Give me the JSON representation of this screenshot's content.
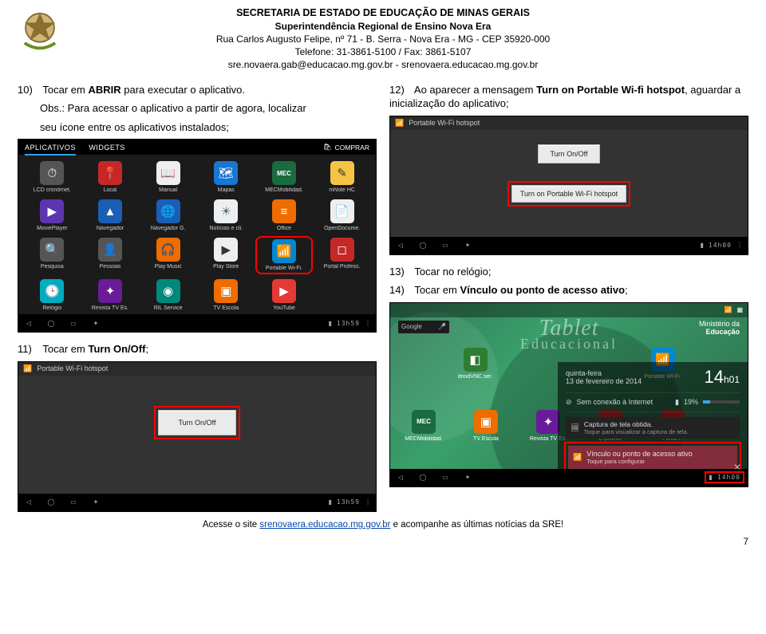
{
  "header": {
    "line1": "SECRETARIA DE ESTADO DE EDUCAÇÃO DE MINAS GERAIS",
    "line2": "Superintendência Regional de Ensino Nova Era",
    "line3": "Rua Carlos Augusto Felipe, nº 71 - B. Serra - Nova Era - MG - CEP 35920-000",
    "line4": "Telefone: 31-3861-5100 / Fax: 3861-5107",
    "line5": "sre.novaera.gab@educacao.mg.gov.br - srenovaera.educacao.mg.gov.br"
  },
  "left": {
    "step10_num": "10)",
    "step10_a": "Tocar em ",
    "step10_b": "ABRIR",
    "step10_c": " para executar o aplicativo.",
    "obs_a": "Obs.: Para acessar o aplicativo a partir de agora, localizar",
    "obs_b": "seu ícone entre os aplicativos instalados;",
    "drawer": {
      "tab1": "APLICATIVOS",
      "tab2": "WIDGETS",
      "shop": "COMPRAR",
      "apps": [
        {
          "label": "LCD cronômet.",
          "cls": "ic-gray",
          "glyph": "⏱"
        },
        {
          "label": "Local",
          "cls": "ic-red",
          "glyph": "📍"
        },
        {
          "label": "Manual",
          "cls": "ic-white",
          "glyph": "📖"
        },
        {
          "label": "Mapas",
          "cls": "ic-map",
          "glyph": "🗺"
        },
        {
          "label": "MECMobilidad.",
          "cls": "ic-mec",
          "glyph": "MEC"
        },
        {
          "label": "mNote HC",
          "cls": "ic-yellow",
          "glyph": "✎"
        },
        {
          "label": "MoviePlayer",
          "cls": "ic-purple",
          "glyph": "▶"
        },
        {
          "label": "Navegador",
          "cls": "ic-blue",
          "glyph": "▲"
        },
        {
          "label": "Navegador G.",
          "cls": "ic-blue",
          "glyph": "🌐"
        },
        {
          "label": "Notícias e cli.",
          "cls": "ic-news",
          "glyph": "☀"
        },
        {
          "label": "Office",
          "cls": "ic-orange",
          "glyph": "≡"
        },
        {
          "label": "OpenDocume.",
          "cls": "ic-white",
          "glyph": "📄"
        },
        {
          "label": "Pesquisa",
          "cls": "ic-gray",
          "glyph": "🔍"
        },
        {
          "label": "Pessoas",
          "cls": "ic-gray",
          "glyph": "👤"
        },
        {
          "label": "Play Music",
          "cls": "ic-orange",
          "glyph": "🎧"
        },
        {
          "label": "Play Store",
          "cls": "ic-white",
          "glyph": "▶"
        },
        {
          "label": "Portable Wi-Fi.",
          "cls": "ic-wifi",
          "glyph": "📶",
          "highlight": true
        },
        {
          "label": "Portal Profess.",
          "cls": "ic-red",
          "glyph": "◻"
        },
        {
          "label": "Relógio",
          "cls": "ic-clock",
          "glyph": "🕒"
        },
        {
          "label": "Revista TV Es.",
          "cls": "ic-pink",
          "glyph": "✦"
        },
        {
          "label": "RIL Service",
          "cls": "ic-teal",
          "glyph": "◉"
        },
        {
          "label": "TV Escola",
          "cls": "ic-orange",
          "glyph": "▣"
        },
        {
          "label": "YouTube",
          "cls": "ic-yt",
          "glyph": "▶"
        }
      ],
      "clock": "13h59"
    },
    "step11_num": "11)",
    "step11_a": "Tocar em ",
    "step11_b": "Turn On/Off",
    "step11_c": ";",
    "hotspot": {
      "title": "Portable Wi-Fi hotspot",
      "btn": "Turn On/Off",
      "clock": "13h59"
    }
  },
  "right": {
    "step12_num": "12)",
    "step12_a": "Ao aparecer a mensagem ",
    "step12_b": "Turn on Portable Wi-fi hotspot",
    "step12_c": ", aguardar a inicialização do aplicativo;",
    "shot12": {
      "title": "Portable Wi-Fi hotspot",
      "btn1": "Turn On/Off",
      "btn2": "Turn on Portable Wi-Fi hotspot",
      "clock": "14h00"
    },
    "step13_num": "13)",
    "step13_text": "Tocar no relógio;",
    "step14_num": "14)",
    "step14_a": "Tocar em ",
    "step14_b": "Vínculo ou ponto de acesso ativo",
    "step14_c": ";",
    "home": {
      "search": "Google",
      "top_icons": [
        {
          "label": "droidVNC ser.",
          "cls": "ic-green",
          "glyph": "◧"
        },
        {
          "label": "Portable Wi-Fi.",
          "cls": "ic-wifi",
          "glyph": "📶"
        }
      ],
      "brand_t1": "Tablet",
      "brand_t2": "Educacional",
      "ministry_a": "Ministério da",
      "ministry_b": "Educação",
      "side_icons": [
        {
          "label": "MECMobilidad.",
          "cls": "ic-mec",
          "glyph": "MEC"
        },
        {
          "label": "TV Escola",
          "cls": "ic-orange",
          "glyph": "▣"
        },
        {
          "label": "Revista TV Es.",
          "cls": "ic-pink",
          "glyph": "✦"
        },
        {
          "label": "E-proinfo",
          "cls": "ic-red",
          "glyph": "◻"
        },
        {
          "label": "Portal P.",
          "cls": "ic-red",
          "glyph": "◻"
        }
      ],
      "panel": {
        "day": "quinta-feira",
        "date": "13 de fevereiro de 2014",
        "clock_h": "14",
        "clock_hm_sep": "h",
        "clock_m": "01",
        "conn": "Sem conexão à Internet",
        "batt": "19%",
        "cap_title": "Captura de tela obtida.",
        "cap_sub": "Toque para visualizar a captura de tela.",
        "link_title": "Vínculo ou ponto de acesso ativo",
        "link_sub": "Toque para configurar",
        "close": "✕"
      },
      "clock_r": "14h00"
    }
  },
  "footer": {
    "a": "Acesse o site ",
    "link": "srenovaera.educacao.mg.gov.br",
    "b": " e acompanhe as últimas notícias da SRE!",
    "page": "7"
  }
}
